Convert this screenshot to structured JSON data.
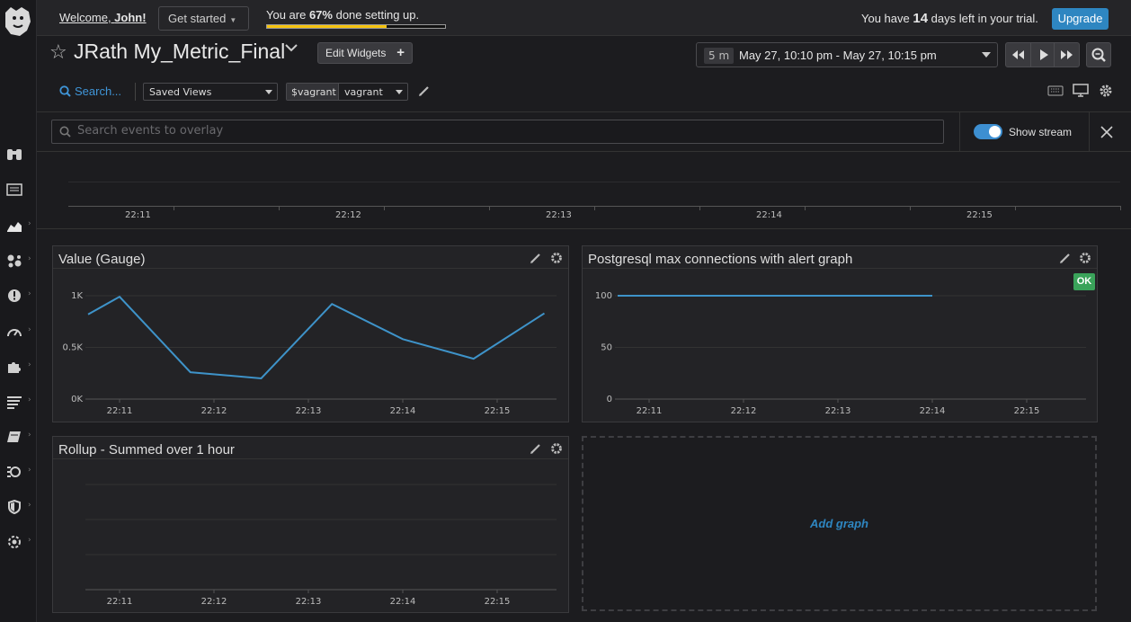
{
  "topbar": {
    "welcome_prefix": "Welcome, ",
    "user_name": "John!",
    "get_started": "Get started",
    "progress_prefix": "You are ",
    "progress_percent_text": "67%",
    "progress_suffix": " done setting up.",
    "progress_fraction": 0.67,
    "trial_prefix": "You have ",
    "trial_days": "14",
    "trial_suffix": " days left in your trial.",
    "upgrade": "Upgrade",
    "progress_color": "#f4c20d",
    "upgrade_color": "#2e86c1"
  },
  "header": {
    "title": "JRath My_Metric_Final",
    "edit_widgets": "Edit Widgets",
    "time_span": "5 m",
    "time_range": "May 27, 10:10 pm - May 27, 10:15 pm"
  },
  "filters": {
    "search": "Search...",
    "saved_views": "Saved Views",
    "var_name": "$vagrant",
    "var_value": "vagrant"
  },
  "overlay": {
    "placeholder": "Search events to overlay",
    "show_stream": "Show stream",
    "show_stream_on": true
  },
  "timeline": {
    "labels": [
      "22:11",
      "22:12",
      "22:13",
      "22:14",
      "22:15"
    ]
  },
  "widgets": {
    "gauge": {
      "title": "Value (Gauge)"
    },
    "postgres": {
      "title": "Postgresql max connections with alert graph",
      "status": "OK"
    },
    "rollup": {
      "title": "Rollup - Summed over 1 hour"
    },
    "add_graph": "Add graph"
  },
  "nav_icons": [
    "binoculars-icon",
    "list-icon",
    "area-chart-icon",
    "infrastructure-icon",
    "monitor-alert-icon",
    "apm-gauge-icon",
    "integrations-puzzle-icon",
    "logs-icon",
    "notebook-icon",
    "synthetics-icon",
    "security-shield-icon",
    "settings-icon"
  ],
  "chart_data": [
    {
      "type": "line",
      "title": "Value (Gauge)",
      "x_ticks": [
        "22:11",
        "22:12",
        "22:13",
        "22:14",
        "22:15"
      ],
      "y_ticks": [
        "0K",
        "0.5K",
        "1K"
      ],
      "ylim": [
        0,
        1000
      ],
      "series": [
        {
          "x": [
            "22:10:40",
            "22:11:00",
            "22:11:45",
            "22:12:30",
            "22:13:15",
            "22:14:00",
            "22:14:45",
            "22:15:30"
          ],
          "values": [
            820,
            990,
            260,
            200,
            920,
            580,
            390,
            830
          ]
        }
      ],
      "color": "#3e93c9"
    },
    {
      "type": "line",
      "title": "Postgresql max connections with alert graph",
      "x_ticks": [
        "22:11",
        "22:12",
        "22:13",
        "22:14",
        "22:15"
      ],
      "y_ticks": [
        "0",
        "50",
        "100"
      ],
      "ylim": [
        0,
        100
      ],
      "series": [
        {
          "x": [
            "22:10:40",
            "22:14:00"
          ],
          "values": [
            100,
            100
          ]
        }
      ],
      "color": "#3e93c9"
    },
    {
      "type": "line",
      "title": "Rollup - Summed over 1 hour",
      "x_ticks": [
        "22:11",
        "22:12",
        "22:13",
        "22:14",
        "22:15"
      ],
      "y_ticks": [],
      "series": []
    }
  ]
}
